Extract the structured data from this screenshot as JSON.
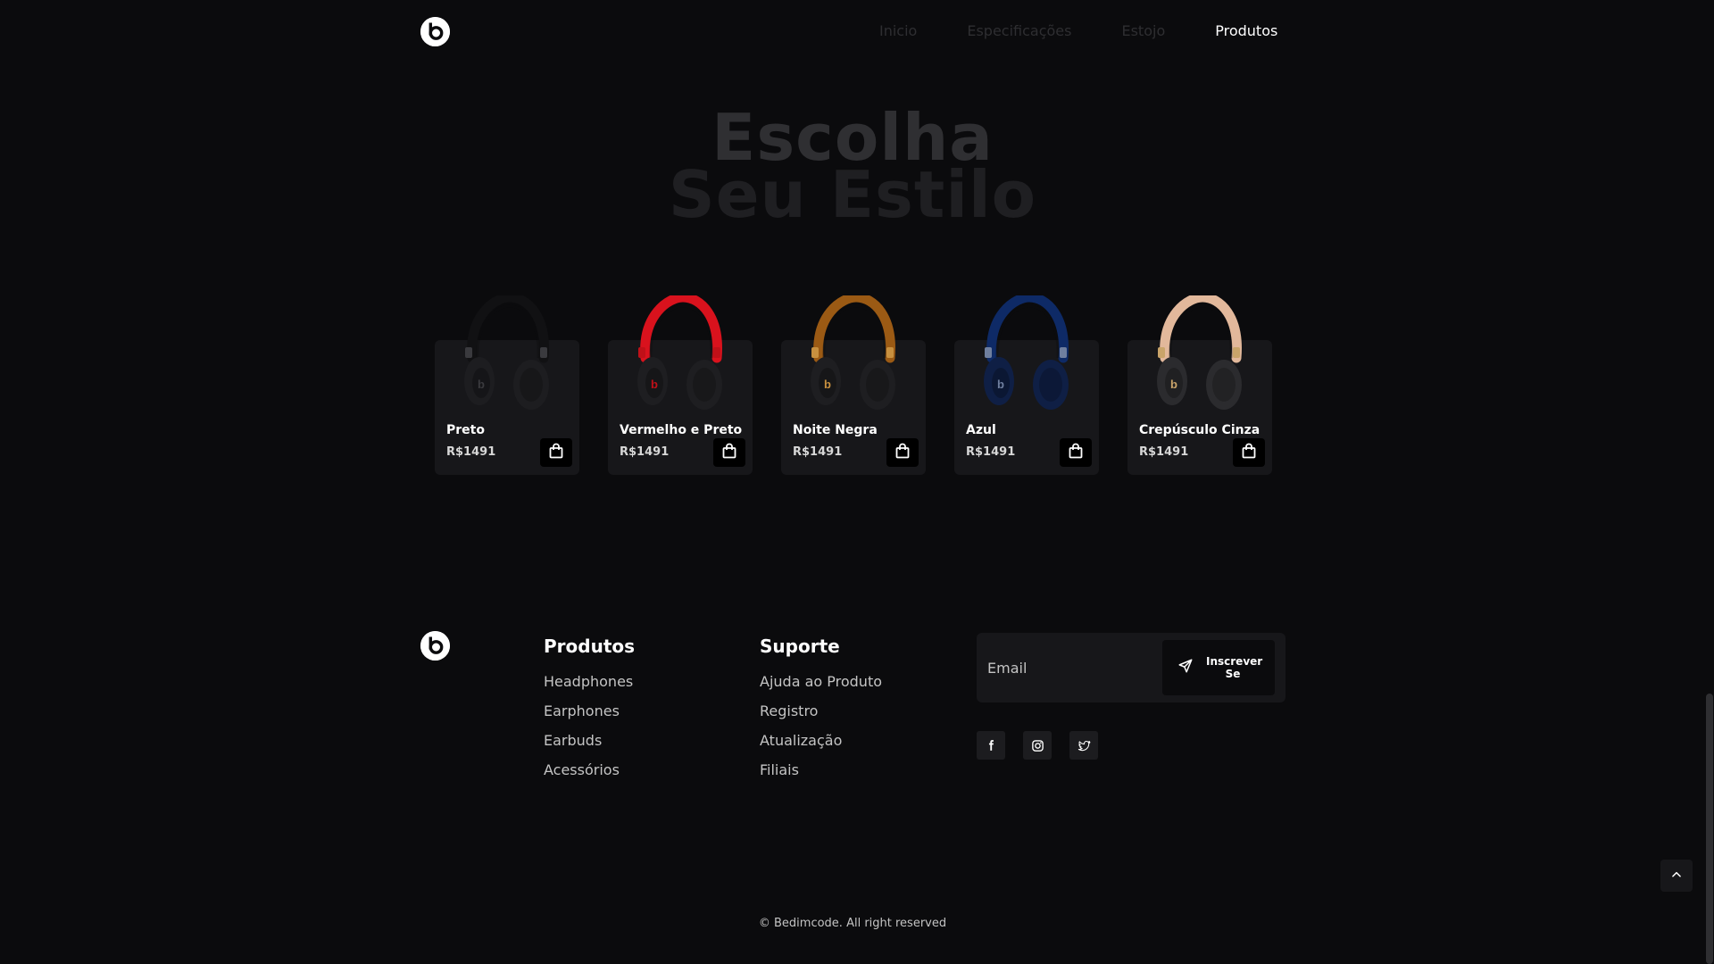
{
  "nav": {
    "items": [
      "Inicio",
      "Especificações",
      "Estojo",
      "Produtos"
    ],
    "active": "Produtos"
  },
  "hero": {
    "line1": "Escolha",
    "line2": "Seu Estilo"
  },
  "products": [
    {
      "name": "Preto",
      "price": "R$1491",
      "cup_color": "#1d1d20",
      "band_color": "#111113",
      "accent": "#3a3a3e"
    },
    {
      "name": "Vermelho e Preto",
      "price": "R$1491",
      "cup_color": "#1e1e21",
      "band_color": "#d9121d",
      "accent": "#c01018"
    },
    {
      "name": "Noite Negra",
      "price": "R$1491",
      "cup_color": "#1e1e21",
      "band_color": "#9b5a14",
      "accent": "#c8903f"
    },
    {
      "name": "Azul",
      "price": "R$1491",
      "cup_color": "#0f1f45",
      "band_color": "#0e2a66",
      "accent": "#6f7f9f"
    },
    {
      "name": "Crepúsculo Cinza",
      "price": "R$1491",
      "cup_color": "#2b2b2e",
      "band_color": "#e2b89b",
      "accent": "#c9a46a"
    }
  ],
  "footer": {
    "products_col": {
      "title": "Produtos",
      "links": [
        "Headphones",
        "Earphones",
        "Earbuds",
        "Acessórios"
      ]
    },
    "support_col": {
      "title": "Suporte",
      "links": [
        "Ajuda ao Produto",
        "Registro",
        "Atualização",
        "Filiais"
      ]
    },
    "newsletter": {
      "placeholder": "Email",
      "button_line1": "Inscrever",
      "button_line2": "Se"
    },
    "socials": [
      "facebook-icon",
      "instagram-icon",
      "twitter-icon"
    ],
    "copyright": "© Bedimcode. All right reserved"
  },
  "colors": {
    "background": "#0b0b0d",
    "card": "#17171a",
    "text": "#ffffff",
    "muted_text": "#c4c4c4",
    "inactive_nav": "#2e2e31"
  }
}
